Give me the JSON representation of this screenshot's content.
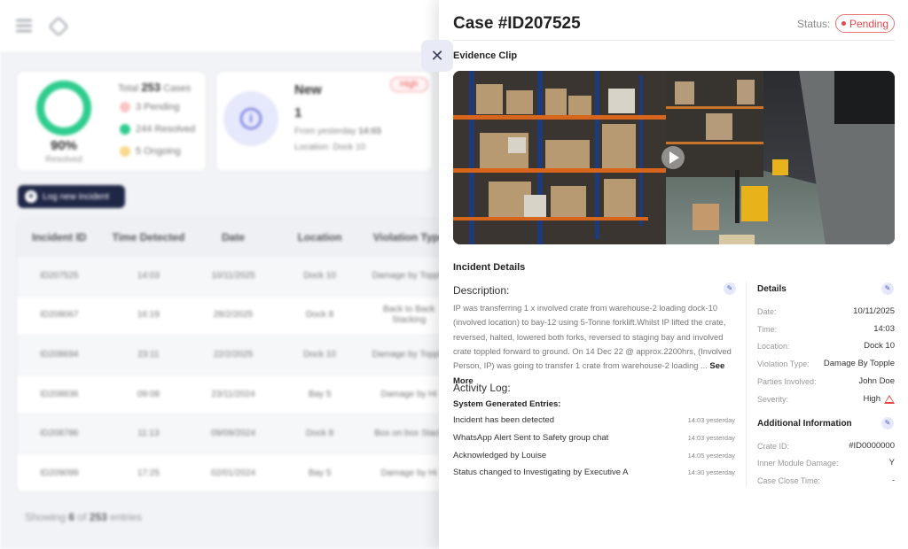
{
  "background": {
    "summary": {
      "percent": "90%",
      "percent_label": "Resolved",
      "total_label": "Total",
      "total_value": "253",
      "total_unit": "Cases",
      "pending": "3 Pending",
      "resolved": "244 Resolved",
      "ongoing": "5 Ongoing"
    },
    "new_card": {
      "title": "New",
      "count": "1",
      "from_label": "From yesterday",
      "from_time": "14:03",
      "location": "Location: Dock 10",
      "severity": "High"
    },
    "log_button_label": "Log new incident",
    "table": {
      "headers": [
        "Incident ID",
        "Time Detected",
        "Date",
        "Location",
        "Violation Type"
      ],
      "rows": [
        [
          "ID207525",
          "14:03",
          "10/11/2025",
          "Dock 10",
          "Damage by Topple"
        ],
        [
          "ID208067",
          "16:19",
          "28/2/2025",
          "Dock 8",
          "Back to Back Stacking"
        ],
        [
          "ID208694",
          "23:11",
          "22/2/2025",
          "Dock 10",
          "Damage by Topple"
        ],
        [
          "ID208836",
          "09:08",
          "23/11/2024",
          "Bay 5",
          "Damage by Hi"
        ],
        [
          "ID208786",
          "11:13",
          "09/09/2024",
          "Dock 8",
          "Box on box Stack"
        ],
        [
          "ID209099",
          "17:25",
          "02/01/2024",
          "Bay 5",
          "Damage by Hi"
        ]
      ]
    },
    "showing": {
      "prefix": "Showing",
      "count": "6",
      "of": "of",
      "total": "253",
      "suffix": "entries"
    }
  },
  "panel": {
    "case_title": "Case #ID207525",
    "status_label": "Status:",
    "status_value": "Pending",
    "status_color": "#e04848",
    "close_symbol": "✕",
    "evidence_heading": "Evidence Clip",
    "incident_heading": "Incident Details",
    "description_label": "Description:",
    "description_text": "IP was transferring 1 x involved crate from warehouse-2 loading dock-10 (involved location) to bay-12 using 5-Tonne forklift.Whilst IP lifted the crate, reversed, halted, lowered both forks, reversed to staging bay and involved crate toppled forward to ground. On 14 Dec 22 @ approx.2200hrs, (Involved Person, IP) was going to transfer 1 crate from warehouse-2 loading ...",
    "see_more": "See More",
    "activity_label": "Activity  Log:",
    "system_generated": "System Generated Entries:",
    "log": [
      {
        "text": "Incident has been detected",
        "time": "14:03 yesterday"
      },
      {
        "text": "WhatsApp Alert Sent to Safety group chat",
        "time": "14:03 yesterday"
      },
      {
        "text": "Acknowledged by Louise",
        "time": "14:05 yesterday"
      },
      {
        "text": "Status changed to Investigating by Executive A",
        "time": "14:30 yesterday"
      }
    ],
    "details_heading": "Details",
    "details": [
      {
        "k": "Date:",
        "v": "10/11/2025"
      },
      {
        "k": "Time:",
        "v": "14:03"
      },
      {
        "k": "Location:",
        "v": "Dock 10"
      },
      {
        "k": "Violation Type:",
        "v": "Damage By Topple"
      },
      {
        "k": "Parties Involved:",
        "v": "John Doe"
      },
      {
        "k": "Severity:",
        "v": "High"
      }
    ],
    "additional_heading": "Additional Information",
    "additional": [
      {
        "k": "Crate ID:",
        "v": "#ID0000000"
      },
      {
        "k": "Inner Module Damage:",
        "v": "Y"
      },
      {
        "k": "Case Close Time:",
        "v": "-"
      }
    ],
    "edit_symbol": "✎",
    "icons": [
      "close-icon",
      "edit-icon",
      "play-icon",
      "warning-icon",
      "menu-icon",
      "cube-icon",
      "info-icon"
    ]
  }
}
